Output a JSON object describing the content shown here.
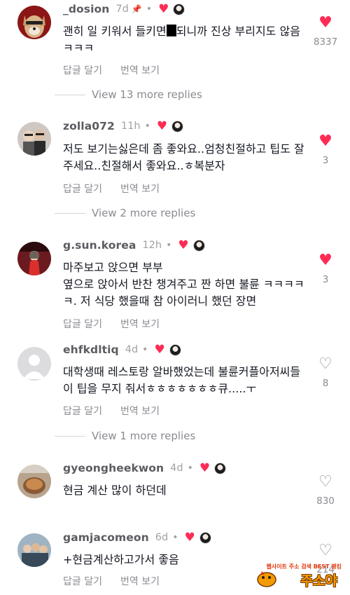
{
  "colors": {
    "accent": "#fe2c55",
    "muted": "#8a8b91",
    "text": "#161823"
  },
  "comments": [
    {
      "username": "_dosion",
      "time": "7d",
      "pinned": true,
      "text_before": "괜히 일 키워서 들키면",
      "text_after": "되니까 진상 부리지도 않음 ㅋㅋㅋ",
      "reply": "답글 달기",
      "translate": "번역 보기",
      "likes": "8337",
      "liked": true,
      "avatar": "dog-avatar"
    },
    {
      "username": "zolla072",
      "time": "11h",
      "text": "저도 보기는싫은데 좀 좋와요..엄청친절하고 팁도 잘주세요..친절해서 좋와요..ㅎ복분자",
      "reply": "답글 달기",
      "translate": "번역 보기",
      "likes": "3",
      "liked": true,
      "avatar": "people-avatar"
    },
    {
      "username": "g.sun.korea",
      "time": "12h",
      "text": "마주보고 앉으면 부부\n옆으로 앉아서 반찬 챙겨주고 짠 하면 불륜 ㅋㅋㅋㅋㅋ. 저 식당 했을때 참 아이러니 했던 장면",
      "reply": "답글 달기",
      "translate": "번역 보기",
      "likes": "3",
      "liked": true,
      "avatar": "person-avatar"
    },
    {
      "username": "ehfkdltiq",
      "time": "4d",
      "text": "대학생때 레스토랑 알바했었는데 불륜커플아저씨들이 팁을 무지 줘서ㅎㅎㅎㅎㅎㅎㅎ큐.....ㅜ",
      "reply": "답글 달기",
      "translate": "번역 보기",
      "likes": "8",
      "liked": false,
      "avatar": "default-avatar"
    },
    {
      "username": "gyeonghee­kwon",
      "time": "4d",
      "text": "현금 계산 많이 하던데",
      "reply": "답글 달기",
      "translate": "번역 보기",
      "likes": "830",
      "liked": false,
      "avatar": "food-avatar"
    },
    {
      "username": "gamjacomeon",
      "time": "6d",
      "text": "+현금계산하고가서 좋음",
      "reply": "답글 달기",
      "translate": "번역 보기",
      "likes": "214",
      "liked": false,
      "avatar": "group-avatar"
    }
  ],
  "view_more": [
    "View 13 more replies",
    "View 2 more replies",
    "View 1 more replies"
  ],
  "watermark": {
    "top": "웹사이트 주소 검색 BEST 랭킹",
    "main": "주소야"
  }
}
